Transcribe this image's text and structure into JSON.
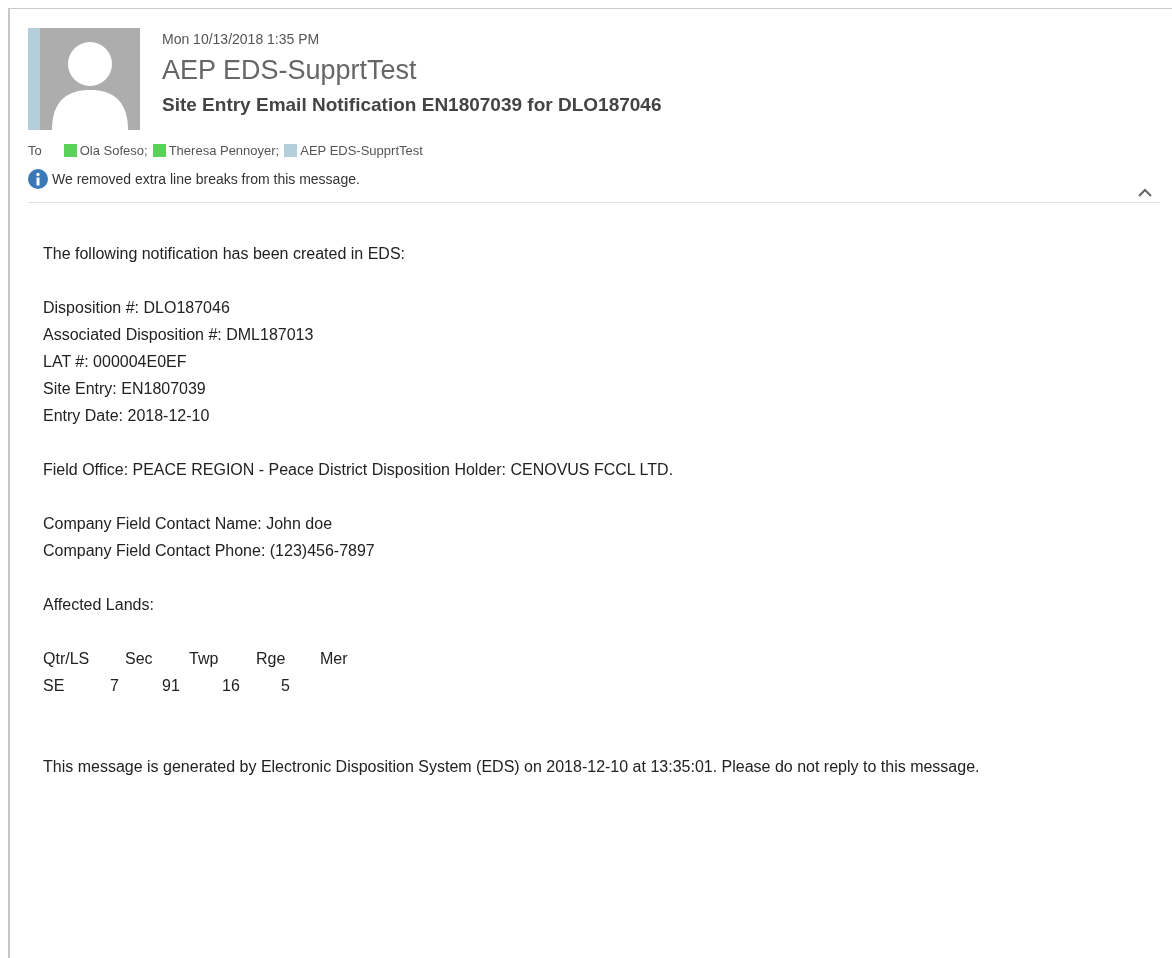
{
  "header": {
    "date": "Mon 10/13/2018 1:35 PM",
    "sender": "AEP EDS-SupprtTest",
    "subject": "Site Entry Email Notification EN1807039 for DLO187046",
    "to_label": "To",
    "recipients": [
      {
        "name": "Ola Sofeso;",
        "color": "#5ad25a"
      },
      {
        "name": "Theresa Pennoyer;",
        "color": "#5ad25a"
      },
      {
        "name": "AEP EDS-SupprtTest",
        "color": "#b4cedb"
      }
    ],
    "info": "We removed extra line breaks from this message.",
    "expanded": true
  },
  "body": {
    "paragraphs": [
      [
        "The following notification has been created in EDS:"
      ],
      [
        "Disposition #: DLO187046",
        "Associated Disposition #: DML187013",
        "LAT #: 000004E0EF",
        "Site Entry: EN1807039",
        "Entry Date: 2018-12-10"
      ],
      [
        "Field Office: PEACE REGION - Peace District Disposition Holder: CENOVUS FCCL LTD."
      ],
      [
        "Company Field Contact Name: John doe",
        "Company Field Contact Phone: (123)456-7897"
      ],
      [
        "Affected Lands:"
      ]
    ],
    "lands": {
      "columns": [
        "Qtr/LS",
        "Sec",
        "Twp",
        "Rge",
        "Mer"
      ],
      "rows": [
        [
          "SE",
          "7",
          "91",
          "16",
          "5"
        ]
      ]
    },
    "footer": "This message is generated by Electronic Disposition System (EDS) on 2018-12-10 at 13:35:01. Please do not reply to this message."
  }
}
